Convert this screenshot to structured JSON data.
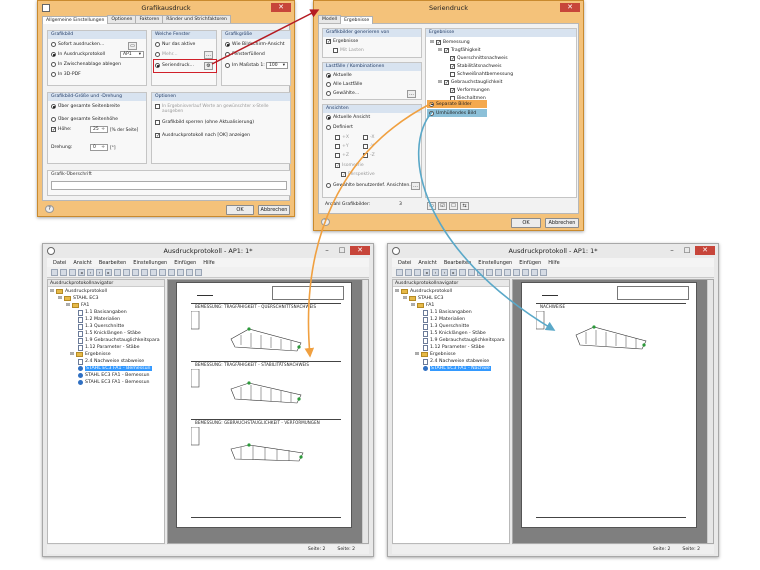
{
  "dlg1": {
    "title": "Grafikausdruck",
    "tabs": [
      "Allgemeine Einstellungen",
      "Optionen",
      "Faktoren",
      "Ränder und Strichfaktoren"
    ],
    "grafikbild": {
      "header": "Grafikbild",
      "opt1": "Sofort ausdrucken...",
      "opt2": "In Ausdruckprotokoll",
      "opt2_value": "AP1",
      "opt3": "In Zwischenablage ablegen",
      "opt4": "In 3D-PDF"
    },
    "fenster": {
      "header": "Welche Fenster",
      "opt1": "Nur das aktive",
      "opt2": "Mehr...",
      "opt3": "Seriendruck..."
    },
    "groesse": {
      "header": "Grafikgröße",
      "opt1": "Wie Bildschirm-Ansicht",
      "opt2": "Fensterfüllend",
      "opt3": "Im Maßstab 1:",
      "scale": "100"
    },
    "drehung": {
      "header": "Grafikbild-Größe und -Drehung",
      "opt1": "Über gesamte Seitenbreite",
      "opt2": "Über gesamte Seitenhöhe",
      "hoehe_label": "Höhe:",
      "hoehe_value": "25",
      "hoehe_unit": "[% der Seite]",
      "drehung_label": "Drehung:",
      "drehung_value": "0",
      "drehung_unit": "[°]"
    },
    "optionen": {
      "header": "Optionen",
      "opt1": "In Ergebnisverlauf Werte an gewünschter x-Stelle ausgeben",
      "opt2": "Grafikbild sperren (ohne Aktualisierung)",
      "opt3": "Ausdruckprotokoll nach [OK] anzeigen"
    },
    "ueberschrift_header": "Grafik-Überschrift",
    "ok": "OK",
    "cancel": "Abbrechen"
  },
  "dlg2": {
    "title": "Seriendruck",
    "tabs": [
      "Modell",
      "Ergebnisse"
    ],
    "generieren": {
      "header": "Grafikbilder generieren von",
      "opt1": "Ergebnisse",
      "opt2": "Mit Lasten"
    },
    "lastfaelle": {
      "header": "Lastfälle / Kombinationen",
      "opt1": "Aktuelle",
      "opt2": "Alle Lastfälle",
      "opt3": "Gewählte..."
    },
    "ansichten": {
      "header": "Ansichten",
      "opt1": "Aktuelle Ansicht",
      "opt2": "Definiert",
      "axes": [
        "+X",
        "-X",
        "+Y",
        "-Y",
        "+Z",
        "-Z"
      ],
      "iso": "Isometrie",
      "persp": "Perspektive",
      "opt3": "Gewählte benutzerdef. Ansichten..."
    },
    "anzahl_label": "Anzahl Grafikbilder:",
    "anzahl_value": "3",
    "ergebnisse_header": "Ergebnisse",
    "tree": [
      "Bemessung",
      "Tragfähigkeit",
      "Querschnittsnachweis",
      "Stabilitätsnachweis",
      "Schweißnahtbemessung",
      "Gebrauchstauglichkeit",
      "Verformungen",
      "Biechaltmen"
    ],
    "separate": "Separate Bilder",
    "umhuellende": "Umhüllendes Bild",
    "ok": "OK",
    "cancel": "Abbrechen"
  },
  "win3": {
    "title": "Ausdruckprotokoll - AP1: 1*",
    "menu": [
      "Datei",
      "Ansicht",
      "Bearbeiten",
      "Einstellungen",
      "Einfügen",
      "Hilfe"
    ],
    "nav_header": "Ausdruckprotokollnavigator",
    "tree": [
      "Ausdruckprotokoll",
      "STAHL EC3",
      "FA1",
      "1.1 Basisangaben",
      "1.2 Materialien",
      "1.3 Querschnitte",
      "1.5 Knicklängen - Stäbe",
      "1.9 Gebrauchstauglichkeitspara",
      "1.12 Parameter - Stäbe",
      "Ergebnisse",
      "2.4 Nachweise stabweise",
      "STAHL EC3 FA1 - Bemessun",
      "STAHL EC3 FA1 - Bemessun",
      "STAHL EC3 FA1 - Bemessun"
    ],
    "sections": [
      "BEMESSUNG: TRAGFÄHIGKEIT - QUERSCHNITTSNACHWEIS",
      "BEMESSUNG: TRAGFÄHIGKEIT - STABILITÄTSNACHWEIS",
      "BEMESSUNG: GEBRAUCHSTAUGLICHKEIT - VERFORMUNGEN"
    ],
    "status": [
      "Seite: 2",
      "Seite: 2"
    ]
  },
  "win4": {
    "title": "Ausdruckprotokoll - AP1: 1*",
    "menu": [
      "Datei",
      "Ansicht",
      "Bearbeiten",
      "Einstellungen",
      "Einfügen",
      "Hilfe"
    ],
    "nav_header": "Ausdruckprotokollnavigator",
    "tree": [
      "Ausdruckprotokoll",
      "STAHL EC3",
      "FA1",
      "1.1 Basisangaben",
      "1.2 Materialien",
      "1.3 Querschnitte",
      "1.5 Knicklängen - Stäbe",
      "1.9 Gebrauchstauglichkeitspara",
      "1.12 Parameter - Stäbe",
      "Ergebnisse",
      "2.4 Nachweise stabweise",
      "STAHL EC3 FA1 - Nachwe"
    ],
    "sections": [
      "NACHWEISE"
    ],
    "status": [
      "Seite: 2",
      "Seite: 2"
    ]
  },
  "colors": {
    "dialog_orange": "#f4c27a",
    "highlight_red": "#d0202a",
    "arrow_orange": "#f0a040",
    "arrow_blue": "#5aa8c8"
  }
}
